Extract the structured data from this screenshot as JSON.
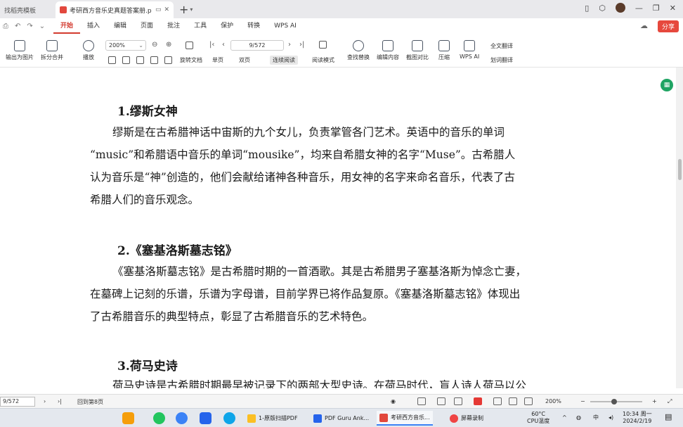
{
  "tabs": [
    {
      "label": "找稻壳模板"
    },
    {
      "label": "考研西方音乐史真题答案册.p"
    }
  ],
  "menu": {
    "items": [
      "开始",
      "插入",
      "编辑",
      "页面",
      "批注",
      "工具",
      "保护",
      "转换",
      "WPS AI"
    ],
    "active": "开始",
    "share_label": "分享"
  },
  "ribbon": {
    "export_image": "输出为图片",
    "split_merge": "拆分合并",
    "play": "播放",
    "zoom_value": "200%",
    "page_value": "9/572",
    "rotate": "旋转文档",
    "single_page": "单页",
    "double_page": "双页",
    "continuous": "连续阅读",
    "read_mode": "阅读模式",
    "find_replace": "查找替换",
    "edit_content": "编辑内容",
    "screenshot_compare": "截图对比",
    "compress": "压缩",
    "wps_ai": "WPS AI",
    "full_translate": "全文翻译",
    "word_translate": "划词翻译"
  },
  "document": {
    "sections": [
      {
        "heading": "1.缪斯女神",
        "lines": [
          "缪斯是在古希腊神话中宙斯的九个女儿，负责掌管各门艺术。英语中的音乐的单词",
          "“music”和希腊语中音乐的单词“mousike”，均来自希腊女神的名字“Muse”。古希腊人",
          "认为音乐是“神”创造的，他们会献给诸神各种音乐，用女神的名字来命名音乐，代表了古",
          "希腊人们的音乐观念。"
        ]
      },
      {
        "heading": "2.《塞基洛斯墓志铭》",
        "lines": [
          "《塞基洛斯墓志铭》是古希腊时期的一首酒歌。其是古希腊男子塞基洛斯为悼念亡妻，",
          "在墓碑上记刻的乐谱，乐谱为字母谱，目前学界已将作品复原。《塞基洛斯墓志铭》体现出",
          "了古希腊音乐的典型特点，彰显了古希腊音乐的艺术特色。"
        ]
      },
      {
        "heading": "3.荷马史诗",
        "lines": [
          "荷马史诗是古希腊时期最早被记录下的两部大型史诗。在荷马时代，盲人诗人荷马以公"
        ]
      }
    ]
  },
  "statusbar": {
    "page_input": "9/572",
    "back_label": "回到第8页",
    "zoom": "200%"
  },
  "taskbar": {
    "windows": [
      "1-原版扫描PDF",
      "PDF Guru Ank...",
      "考研西方音乐...",
      "屏幕录制"
    ],
    "temp": "60°C",
    "cpu": "CPU温度",
    "time": "10:34 周一",
    "date": "2024/2/19"
  },
  "colors": {
    "accent": "#d33b2f",
    "share": "#e6483d",
    "taskbar": "#e4e8ee"
  }
}
